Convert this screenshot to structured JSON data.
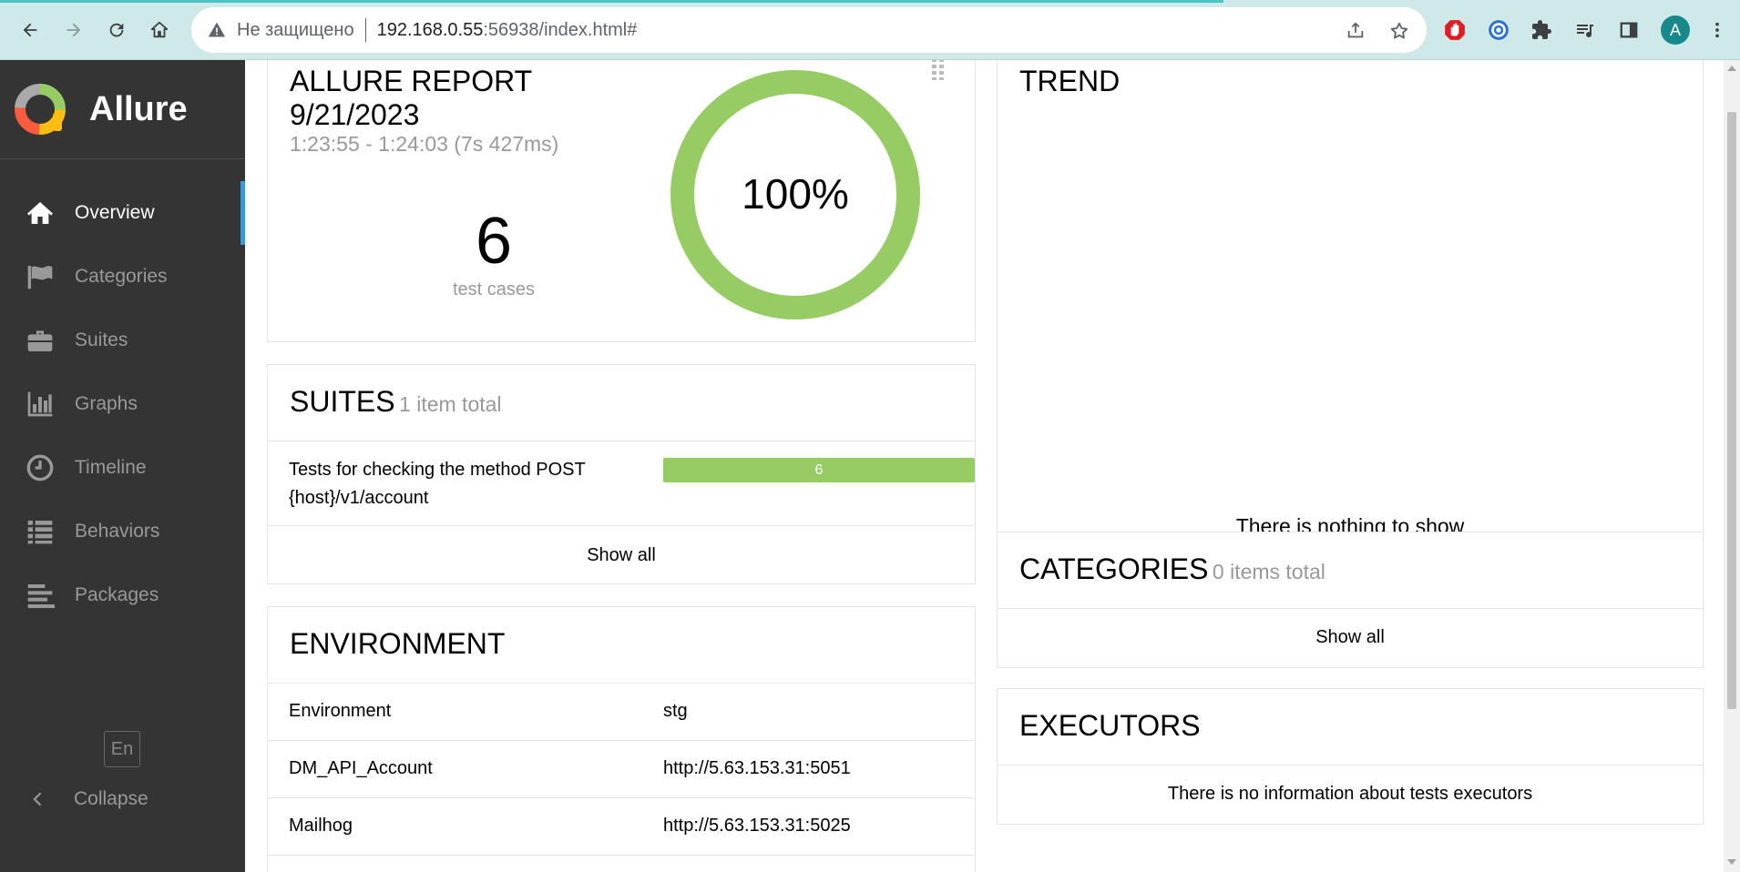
{
  "browser": {
    "security_label": "Не защищено",
    "url_host": "192.168.0.55",
    "url_rest": ":56938/index.html#",
    "profile_initial": "A",
    "icons": [
      "back-arrow-icon",
      "forward-arrow-icon",
      "reload-icon",
      "home-icon",
      "warning-icon",
      "share-icon",
      "star-icon",
      "adblock-icon",
      "extension-ring-icon",
      "puzzle-icon",
      "media-queue-icon",
      "side-panel-icon"
    ]
  },
  "sidebar": {
    "brand": "Allure",
    "items": [
      {
        "label": "Overview",
        "icon": "home-icon",
        "active": true
      },
      {
        "label": "Categories",
        "icon": "flag-icon",
        "active": false
      },
      {
        "label": "Suites",
        "icon": "briefcase-icon",
        "active": false
      },
      {
        "label": "Graphs",
        "icon": "bar-chart-icon",
        "active": false
      },
      {
        "label": "Timeline",
        "icon": "clock-icon",
        "active": false
      },
      {
        "label": "Behaviors",
        "icon": "list-icon",
        "active": false
      },
      {
        "label": "Packages",
        "icon": "align-left-icon",
        "active": false
      }
    ],
    "language": "En",
    "collapse_label": "Collapse"
  },
  "summary": {
    "title_line1": "ALLURE REPORT",
    "title_line2": "9/21/2023",
    "time_range": "1:23:55 - 1:24:03 (7s 427ms)",
    "test_count": "6",
    "test_count_label": "test cases",
    "pass_rate": "100%",
    "pass_fraction": 1.0,
    "pass_color": "#97cc64"
  },
  "suites": {
    "title": "SUITES",
    "subtitle": "1 item total",
    "rows": [
      {
        "name": "Tests for checking the method POST {host}/v1/account",
        "passed": "6"
      }
    ],
    "show_all": "Show all"
  },
  "environment": {
    "title": "ENVIRONMENT",
    "rows": [
      {
        "key": "Environment",
        "value": "stg"
      },
      {
        "key": "DM_API_Account",
        "value": "http://5.63.153.31:5051"
      },
      {
        "key": "Mailhog",
        "value": "http://5.63.153.31:5025"
      }
    ]
  },
  "trend": {
    "title": "TREND",
    "empty_text": "There is nothing to show"
  },
  "categories": {
    "title": "CATEGORIES",
    "subtitle": "0 items total",
    "show_all": "Show all"
  },
  "executors": {
    "title": "EXECUTORS",
    "empty_text": "There is no information about tests executors"
  }
}
